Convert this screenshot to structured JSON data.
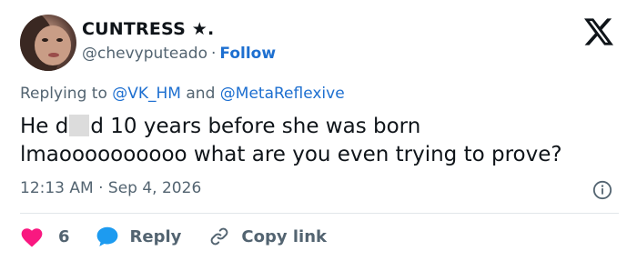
{
  "author": {
    "display_name": "CUNTRESS ★.",
    "handle": "@chevyputeado",
    "separator": "·",
    "follow_label": "Follow"
  },
  "reply_context": {
    "prefix": "Replying to",
    "mentions": [
      "@VK_HM",
      "@MetaReflexive"
    ],
    "conjunction": "and"
  },
  "tweet": {
    "text_before_censor": "He d",
    "text_after_censor": "d 10 years before she was born",
    "line2": "lmaoooooooooo what are you even trying to prove?"
  },
  "meta": {
    "time": "12:13 AM",
    "separator": "·",
    "date": "Sep 4, 2026"
  },
  "actions": {
    "likes": "6",
    "reply_label": "Reply",
    "copy_link_label": "Copy link"
  },
  "colors": {
    "like": "#f91880",
    "reply": "#1d9bf0",
    "link": "#1d6fd0",
    "secondary_text": "#536471"
  },
  "icons": [
    "x-logo-icon",
    "info-icon",
    "heart-icon",
    "reply-bubble-icon",
    "link-icon"
  ]
}
